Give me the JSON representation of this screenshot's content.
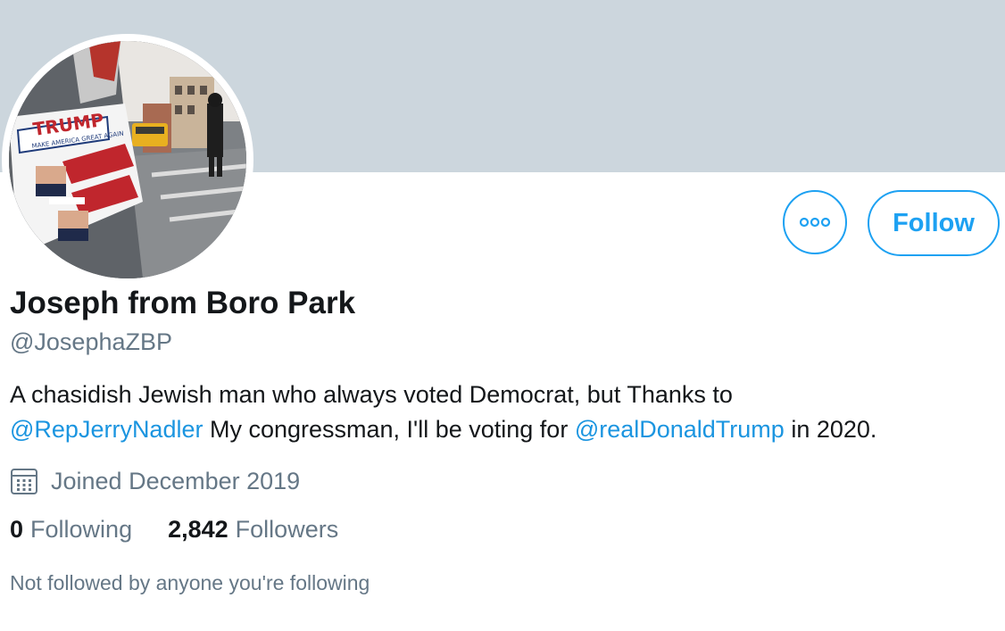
{
  "profile": {
    "display_name": "Joseph from Boro Park",
    "handle": "@JosephaZBP",
    "bio": {
      "line1": "A chasidish Jewish man who always voted Democrat, but Thanks to",
      "mention1": "@RepJerryNadler",
      "text2": " My congressman, I'll be voting for ",
      "mention2": "@realDonaldTrump",
      "text3": " in 2020."
    },
    "avatar_icon": "profile-photo",
    "avatar_sign_text": {
      "trump": "TRUMP",
      "slogan": "MAKE AMERICA GREAT AGAIN"
    },
    "joined": "Joined December 2019",
    "following_count": "0",
    "following_label": "Following",
    "followers_count": "2,842",
    "followers_label": "Followers",
    "not_followed_text": "Not followed by anyone you're following"
  },
  "actions": {
    "more_icon": "more-options-icon",
    "follow_label": "Follow"
  },
  "colors": {
    "banner": "#ccd6dd",
    "accent": "#1da1f2",
    "mention": "#1b95e0",
    "primary_text": "#14171a",
    "secondary_text": "#657786"
  }
}
